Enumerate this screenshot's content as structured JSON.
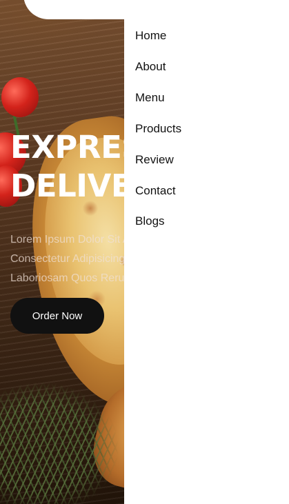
{
  "hero": {
    "headline_line1": "EXPRESS",
    "headline_line2": "DELIVERY",
    "lede": "Lorem Ipsum Dolor Sit Amet Consectetur Adipisicing Elit. Laboriosam Quos Rerum Quas?",
    "order_button_label": "Order Now"
  },
  "nav": {
    "items": [
      {
        "label": "Home"
      },
      {
        "label": "About"
      },
      {
        "label": "Menu"
      },
      {
        "label": "Products"
      },
      {
        "label": "Review"
      },
      {
        "label": "Contact"
      },
      {
        "label": "Blogs"
      }
    ]
  },
  "colors": {
    "nav_background": "#ffffff",
    "button_background": "#111111",
    "headline": "#ffffff"
  },
  "icons": {
    "logo": "brand-logo-icon"
  }
}
